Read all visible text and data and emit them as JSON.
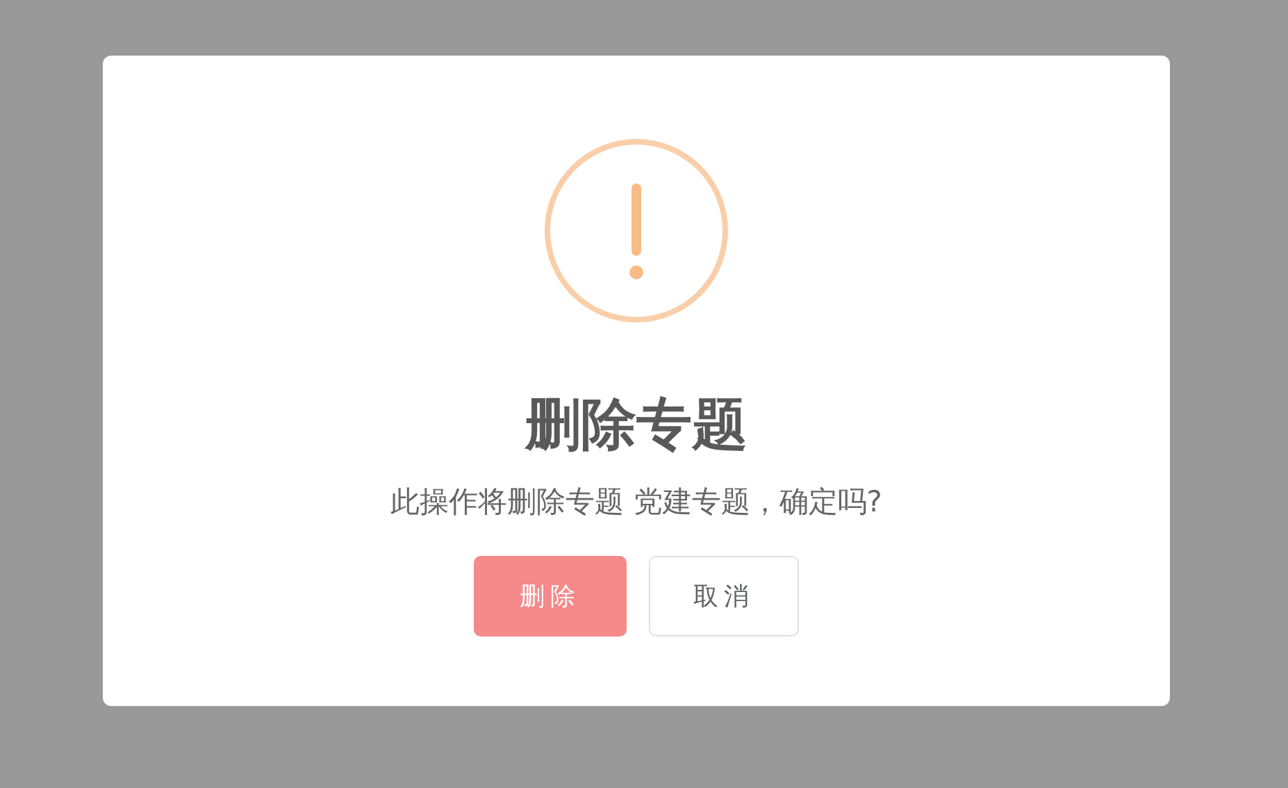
{
  "dialog": {
    "title": "删除专题",
    "message": "此操作将删除专题 党建专题，确定吗?",
    "buttons": [
      {
        "label": "删除",
        "kind": "confirm"
      },
      {
        "label": "取消",
        "kind": "cancel"
      }
    ]
  }
}
